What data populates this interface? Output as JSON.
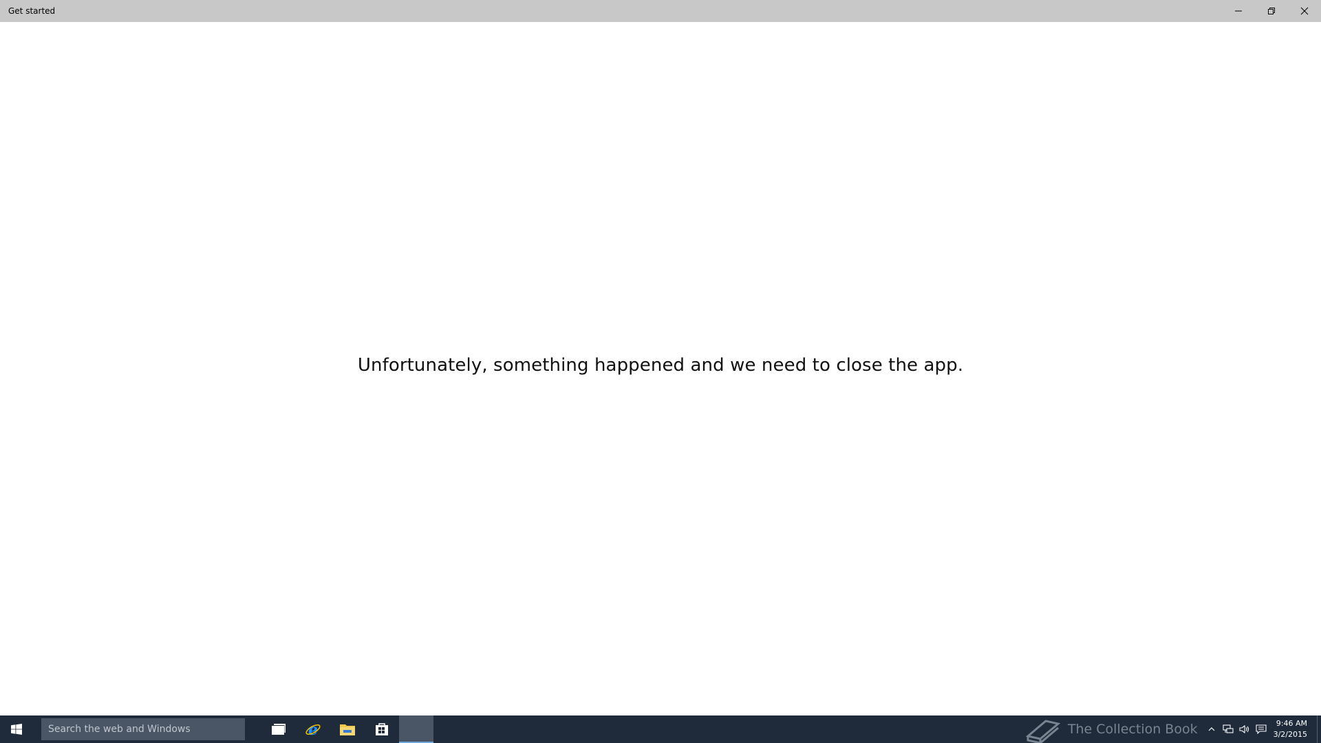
{
  "window": {
    "title": "Get started",
    "controls": {
      "minimize": "minimize-icon",
      "maximize": "restore-icon",
      "close": "close-icon"
    }
  },
  "main": {
    "message": "Unfortunately, something happened and we need to close the app."
  },
  "taskbar": {
    "search_placeholder": "Search the web and Windows",
    "pinned": [
      {
        "name": "task-view-icon"
      },
      {
        "name": "internet-explorer-icon"
      },
      {
        "name": "file-explorer-icon"
      },
      {
        "name": "store-icon"
      },
      {
        "name": "active-app",
        "active": true
      }
    ],
    "watermark": "The Collection Book",
    "clock": {
      "time": "9:46 AM",
      "date": "3/2/2015"
    }
  },
  "colors": {
    "titlebar": "#c8c8c8",
    "taskbar": "#1f2a3a",
    "search_box": "#4a5566",
    "accent": "#6fa8dc"
  }
}
